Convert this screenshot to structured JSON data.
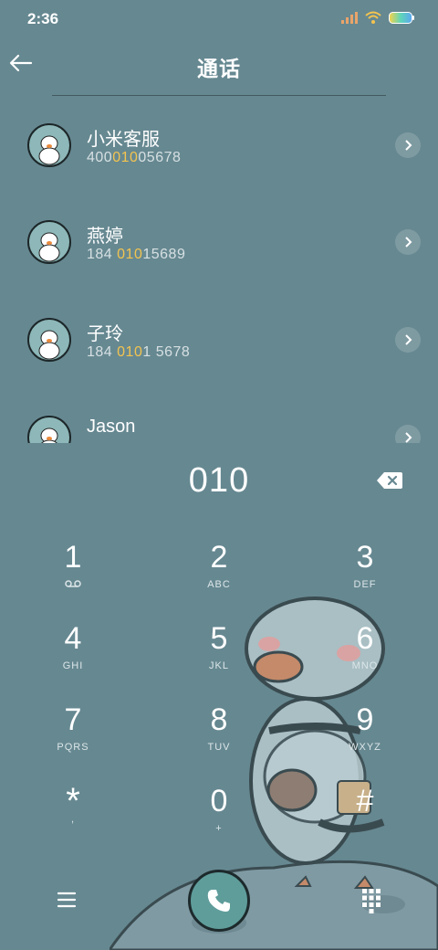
{
  "status": {
    "time": "2:36"
  },
  "header": {
    "title": "通话"
  },
  "contacts": [
    {
      "name": "小米客服",
      "num_pre": "400",
      "num_hl": "010",
      "num_post": "05678"
    },
    {
      "name": "燕婷",
      "num_pre": "184 ",
      "num_hl": "010",
      "num_post": "15689"
    },
    {
      "name": "子玲",
      "num_pre": "184 ",
      "num_hl": "010",
      "num_post": "1 5678"
    },
    {
      "name": "Jason",
      "num_pre": "",
      "num_hl": "",
      "num_post": ""
    }
  ],
  "dialer": {
    "number": "010"
  },
  "keypad": [
    {
      "digit": "1",
      "letters": ""
    },
    {
      "digit": "2",
      "letters": "ABC"
    },
    {
      "digit": "3",
      "letters": "DEF"
    },
    {
      "digit": "4",
      "letters": "GHI"
    },
    {
      "digit": "5",
      "letters": "JKL"
    },
    {
      "digit": "6",
      "letters": "MNO"
    },
    {
      "digit": "7",
      "letters": "PQRS"
    },
    {
      "digit": "8",
      "letters": "TUV"
    },
    {
      "digit": "9",
      "letters": "WXYZ"
    },
    {
      "digit": "*",
      "letters": ","
    },
    {
      "digit": "0",
      "letters": "+"
    },
    {
      "digit": "#",
      "letters": ""
    }
  ],
  "colors": {
    "background": "#668891",
    "highlight": "#f3c44f",
    "call_button": "#5f9d9b"
  },
  "icons": {
    "back": "arrow-left-icon",
    "chevron": "chevron-right-icon",
    "backspace": "backspace-icon",
    "voicemail": "voicemail-icon",
    "menu": "menu-icon",
    "call": "phone-icon",
    "dialpad": "dialpad-icon"
  }
}
